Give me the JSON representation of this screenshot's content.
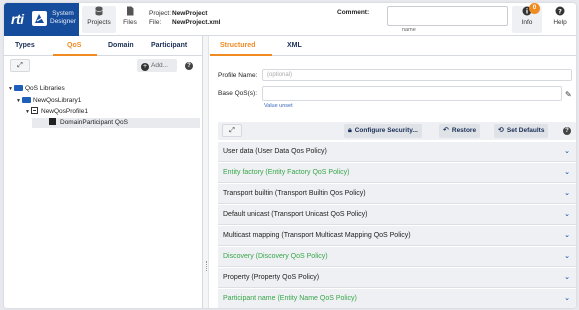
{
  "app": {
    "brand": "rti",
    "product_line1": "System",
    "product_line2": "Designer"
  },
  "toolbar": {
    "projects_label": "Projects",
    "files_label": "Files",
    "info_label": "Info",
    "info_badge": "0",
    "help_label": "Help"
  },
  "project": {
    "project_key": "Project:",
    "project_value": "NewProject",
    "file_key": "File:",
    "file_value": "NewProject.xml",
    "comment_label": "Comment:",
    "comment_value": "",
    "comment_sub": "name"
  },
  "left_panel": {
    "tabs": [
      {
        "label": "Types",
        "active": false
      },
      {
        "label": "QoS",
        "active": true
      },
      {
        "label": "Domain",
        "active": false
      },
      {
        "label": "Participant",
        "active": false
      }
    ],
    "add_label": "Add...",
    "help_glyph": "?",
    "tree": [
      {
        "label": "QoS Libraries",
        "icon": "folder-icon",
        "level": 0
      },
      {
        "label": "NewQosLibrary1",
        "icon": "folder-icon",
        "level": 1
      },
      {
        "label": "NewQosProfile1",
        "icon": "profile-icon",
        "level": 2
      },
      {
        "label": "DomainParticipant QoS",
        "icon": "qos-icon",
        "level": 3,
        "selected": true
      }
    ]
  },
  "right_panel": {
    "tabs": [
      {
        "label": "Structured",
        "active": true
      },
      {
        "label": "XML",
        "active": false
      }
    ],
    "profile_name_label": "Profile Name:",
    "profile_name_placeholder": "(optional)",
    "base_qos_label": "Base QoS(s):",
    "value_unset": "Value unset",
    "buttons": {
      "configure_security": "Configure Security...",
      "restore": "Restore",
      "set_defaults": "Set Defaults"
    },
    "policies": [
      {
        "label": "User data (User Data Qos Policy)",
        "green": false
      },
      {
        "label": "Entity factory (Entity Factory QoS Policy)",
        "green": true
      },
      {
        "label": "Transport builtin (Transport Builtin Qos Policy)",
        "green": false
      },
      {
        "label": "Default unicast (Transport Unicast QoS Policy)",
        "green": false
      },
      {
        "label": "Multicast mapping (Transport Multicast Mapping QoS Policy)",
        "green": false
      },
      {
        "label": "Discovery (Discovery QoS Policy)",
        "green": true
      },
      {
        "label": "Property (Property QoS Policy)",
        "green": false
      },
      {
        "label": "Participant name (Entity Name QoS Policy)",
        "green": true
      }
    ]
  },
  "colors": {
    "brand_blue": "#154c9b",
    "accent_orange": "#f08b22",
    "modified_green": "#38a64a",
    "link_blue": "#1d5fb8"
  }
}
